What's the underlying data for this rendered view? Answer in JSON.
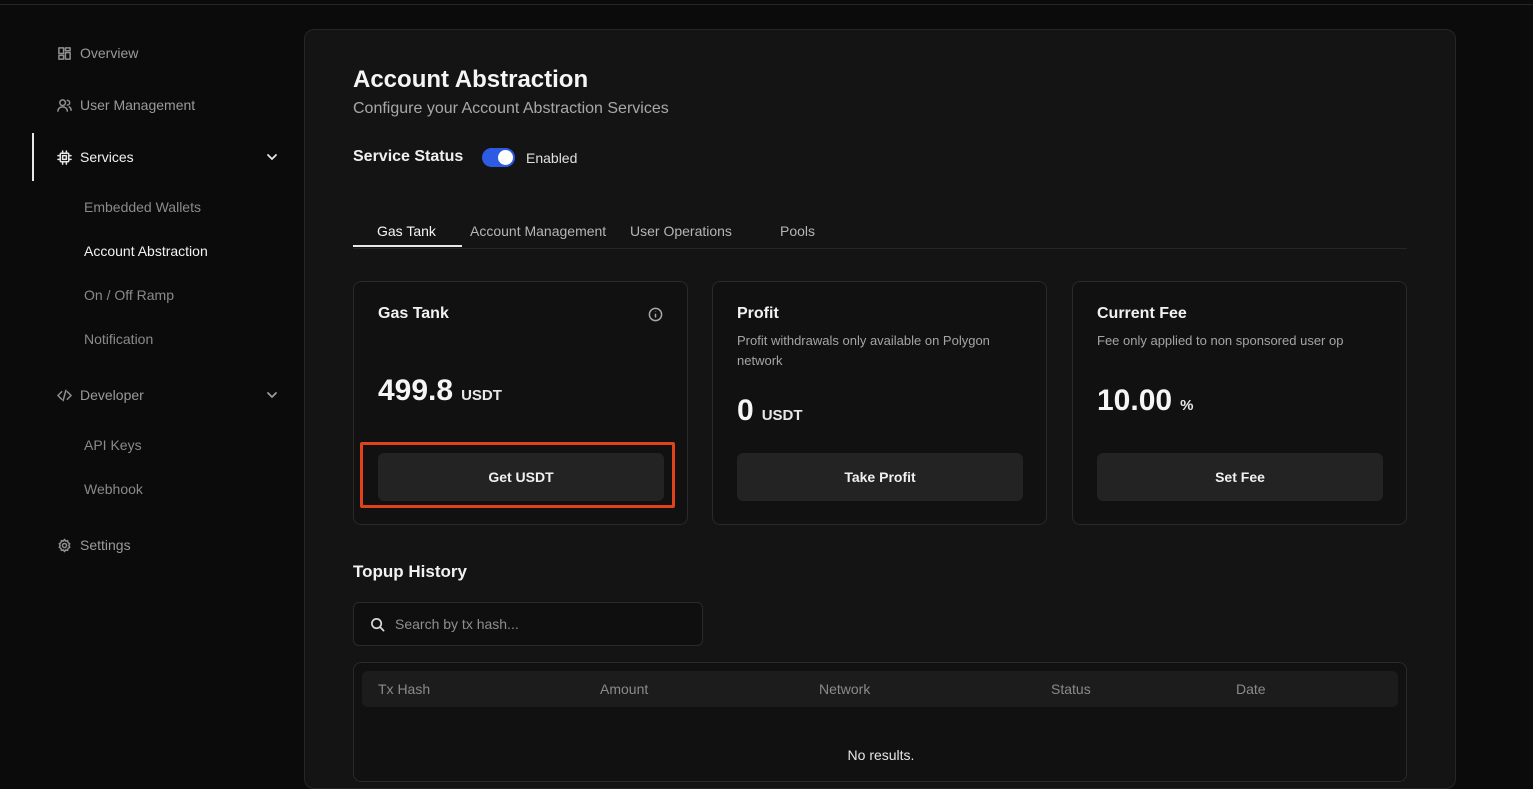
{
  "sidebar": {
    "overview": "Overview",
    "user_management": "User Management",
    "services": "Services",
    "services_items": [
      "Embedded Wallets",
      "Account Abstraction",
      "On / Off Ramp",
      "Notification"
    ],
    "developer": "Developer",
    "developer_items": [
      "API Keys",
      "Webhook"
    ],
    "settings": "Settings"
  },
  "header": {
    "title": "Account Abstraction",
    "subtitle": "Configure your Account Abstraction Services",
    "status_label": "Service Status",
    "status_value": "Enabled"
  },
  "tabs": [
    "Gas Tank",
    "Account Management",
    "User Operations",
    "Pools"
  ],
  "cards": {
    "gas_tank": {
      "title": "Gas Tank",
      "value": "499.8",
      "unit": "USDT",
      "button": "Get USDT"
    },
    "profit": {
      "title": "Profit",
      "description": "Profit withdrawals only available on Polygon network",
      "value": "0",
      "unit": "USDT",
      "button": "Take Profit"
    },
    "fee": {
      "title": "Current Fee",
      "description": "Fee only applied to non sponsored user op",
      "value": "10.00",
      "unit": "%",
      "button": "Set Fee"
    }
  },
  "history": {
    "title": "Topup History",
    "search_placeholder": "Search by tx hash...",
    "columns": [
      "Tx Hash",
      "Amount",
      "Network",
      "Status",
      "Date"
    ],
    "empty": "No results."
  },
  "colors": {
    "accent": "#2d5be3",
    "highlight": "#e0431b"
  }
}
